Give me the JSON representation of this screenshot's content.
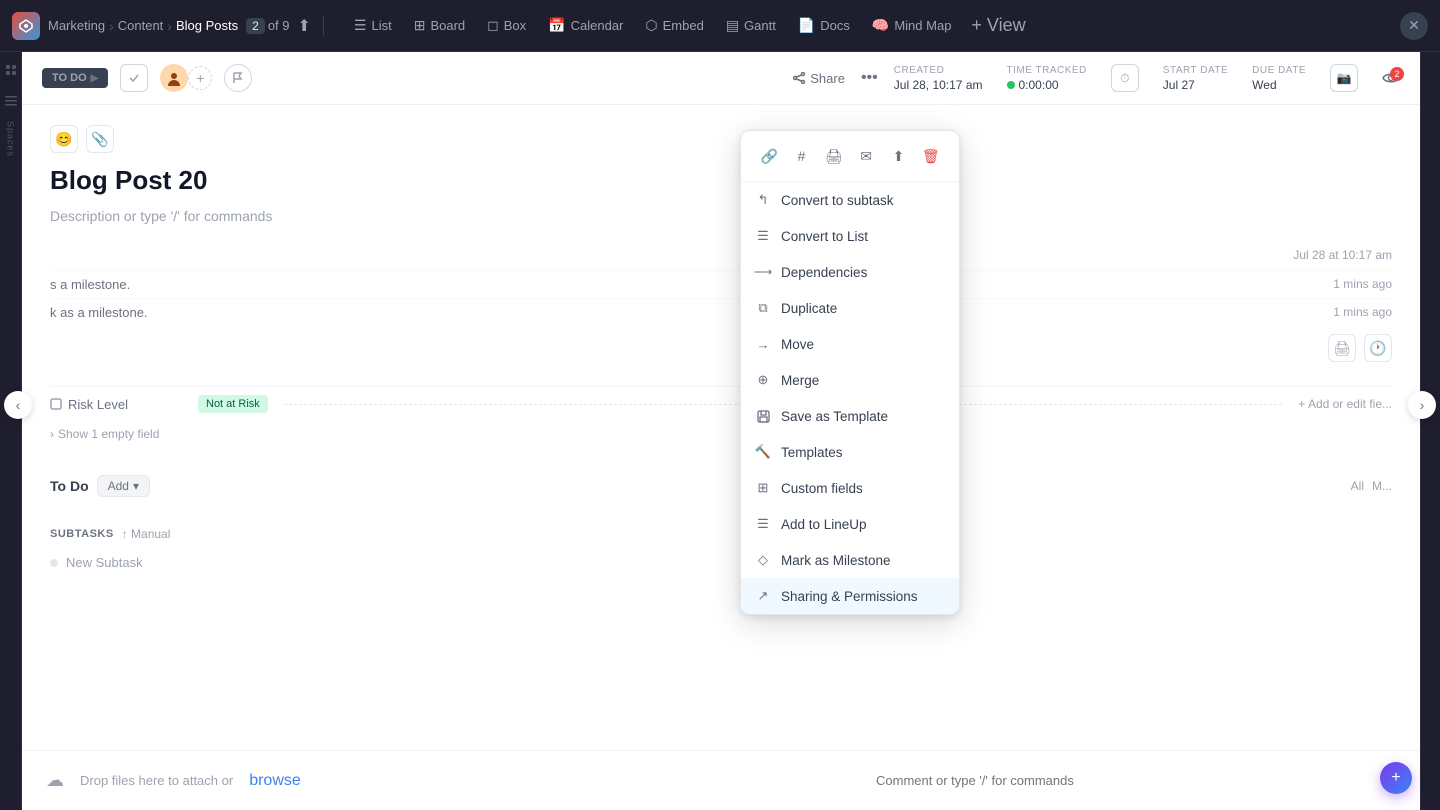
{
  "topNav": {
    "breadcrumb": [
      "Marketing",
      "Content",
      "Blog Posts"
    ],
    "current_num": "2",
    "total": "of 9",
    "tabs": [
      {
        "id": "list",
        "icon": "☰",
        "label": "List"
      },
      {
        "id": "board",
        "icon": "⊞",
        "label": "Board"
      },
      {
        "id": "box",
        "icon": "◻",
        "label": "Box"
      },
      {
        "id": "calendar",
        "icon": "📅",
        "label": "Calendar"
      },
      {
        "id": "embed",
        "icon": "⬡",
        "label": "Embed"
      },
      {
        "id": "gantt",
        "icon": "▤",
        "label": "Gantt"
      },
      {
        "id": "docs",
        "icon": "📄",
        "label": "Docs"
      },
      {
        "id": "mindmap",
        "icon": "🧠",
        "label": "Mind Map"
      }
    ],
    "view_btn": "+ View",
    "spaces_label": "Spaces"
  },
  "taskHeader": {
    "status": "TO DO",
    "share_label": "Share",
    "created_label": "CREATED",
    "created_value": "Jul 28, 10:17 am",
    "time_tracked_label": "TIME TRACKED",
    "time_tracked_value": "0:00:00",
    "start_date_label": "START DATE",
    "start_date_value": "Jul 27",
    "due_date_label": "DUE DATE",
    "due_date_value": "Wed",
    "eye_count": "2"
  },
  "task": {
    "title": "Blog Post 20",
    "description": "Description or type '/' for commands"
  },
  "activity": [
    {
      "text": "s a milestone.",
      "time": "1 mins ago"
    },
    {
      "text": "k as a milestone.",
      "time": "1 mins ago"
    }
  ],
  "activityDate": "Jul 28 at 10:17 am",
  "fields": {
    "risk_level_label": "Risk Level",
    "risk_value": "Not at Risk",
    "show_empty": "Show 1 empty field",
    "add_field": "+ Add or edit fie..."
  },
  "todo": {
    "title": "To Do",
    "add_label": "Add",
    "nav_all": "All",
    "nav_m": "M..."
  },
  "subtasks": {
    "label": "SUBTASKS",
    "manual_label": "↑ Manual",
    "new_subtask": "New Subtask"
  },
  "dropdown": {
    "icons": [
      {
        "name": "link-icon",
        "symbol": "🔗"
      },
      {
        "name": "hash-icon",
        "symbol": "#"
      },
      {
        "name": "print-icon",
        "symbol": "🖨"
      },
      {
        "name": "email-icon",
        "symbol": "✉"
      },
      {
        "name": "export-icon",
        "symbol": "⬆"
      },
      {
        "name": "delete-icon",
        "symbol": "🗑",
        "danger": true
      }
    ],
    "items": [
      {
        "id": "convert-subtask",
        "label": "Convert to subtask",
        "icon": "↰"
      },
      {
        "id": "convert-list",
        "label": "Convert to List",
        "icon": "☰"
      },
      {
        "id": "dependencies",
        "label": "Dependencies",
        "icon": "⟶"
      },
      {
        "id": "duplicate",
        "label": "Duplicate",
        "icon": "⧉"
      },
      {
        "id": "move",
        "label": "Move",
        "icon": "→"
      },
      {
        "id": "merge",
        "label": "Merge",
        "icon": "⊕"
      },
      {
        "id": "save-template",
        "label": "Save as Template",
        "icon": "💾"
      },
      {
        "id": "templates",
        "label": "Templates",
        "icon": "🔨"
      },
      {
        "id": "custom-fields",
        "label": "Custom fields",
        "icon": "⊞"
      },
      {
        "id": "add-lineup",
        "label": "Add to LineUp",
        "icon": "☰"
      },
      {
        "id": "mark-milestone",
        "label": "Mark as Milestone",
        "icon": "◇"
      },
      {
        "id": "sharing",
        "label": "Sharing & Permissions",
        "icon": "↗",
        "active": true
      }
    ]
  },
  "bottomBar": {
    "drop_text": "Drop files here to attach or ",
    "browse_text": "browse",
    "comment_placeholder": "Comment or type '/' for commands"
  }
}
